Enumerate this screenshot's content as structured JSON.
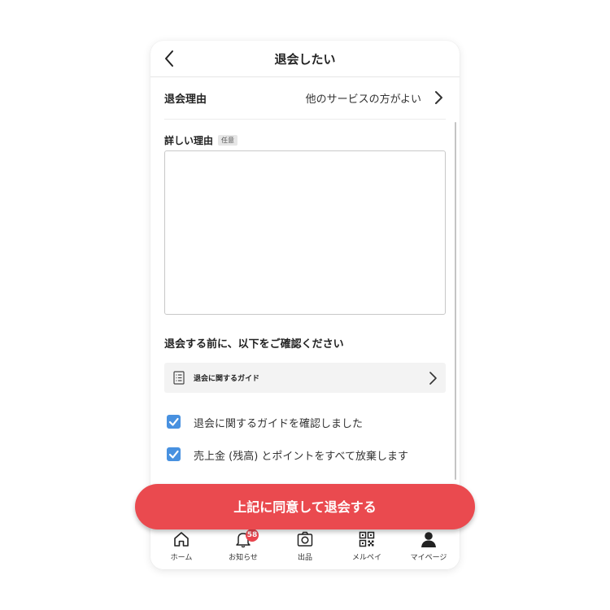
{
  "header": {
    "title": "退会したい"
  },
  "reason": {
    "label": "退会理由",
    "value": "他のサービスの方がよい"
  },
  "detail": {
    "label": "詳しい理由",
    "optional_badge": "任意",
    "value": "",
    "placeholder": ""
  },
  "confirm": {
    "title": "退会する前に、以下をご確認ください",
    "guide_link": "退会に関するガイド",
    "checks": [
      {
        "text": "退会に関するガイドを確認しました",
        "checked": true
      },
      {
        "text": "売上金 (残高) とポイントをすべて放棄します",
        "checked": true
      }
    ]
  },
  "cta": {
    "label": "上記に同意して退会する"
  },
  "tabbar": {
    "items": [
      {
        "label": "ホーム",
        "icon": "home-icon"
      },
      {
        "label": "お知らせ",
        "icon": "bell-icon",
        "badge": "58"
      },
      {
        "label": "出品",
        "icon": "camera-icon"
      },
      {
        "label": "メルペイ",
        "icon": "qr-icon"
      },
      {
        "label": "マイページ",
        "icon": "person-icon"
      }
    ]
  },
  "colors": {
    "accent": "#ea4a4f",
    "check": "#4891e0",
    "badge": "#e8454d"
  }
}
